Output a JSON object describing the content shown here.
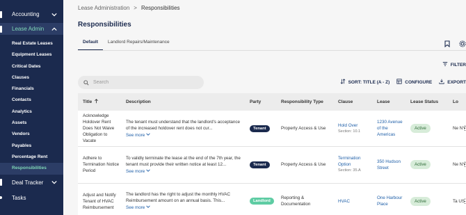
{
  "sidebar": {
    "accounting": "Accounting",
    "lease_admin": "Lease Admin",
    "items": [
      {
        "label": "Real Estate Leases"
      },
      {
        "label": "Equipment Leases"
      },
      {
        "label": "Critical Dates"
      },
      {
        "label": "Clauses"
      },
      {
        "label": "Financials"
      },
      {
        "label": "Contacts"
      },
      {
        "label": "Analytics"
      },
      {
        "label": "Assets"
      },
      {
        "label": "Vendors"
      },
      {
        "label": "Payables"
      },
      {
        "label": "Percentage Rent"
      },
      {
        "label": "Responsibilities"
      }
    ],
    "deal_tracker": "Deal Tracker",
    "tasks": "Tasks"
  },
  "breadcrumb": {
    "parent": "Lease Administration",
    "separator": ">",
    "current": "Responsibilities"
  },
  "page_title": "Responsibilities",
  "tabs": [
    {
      "label": "Default"
    },
    {
      "label": "Landlord Repairs/Maintenance"
    }
  ],
  "filter_label": "FILTER",
  "search": {
    "placeholder": "Search"
  },
  "toolbar": {
    "sort_label": "SORT: TITLE (A - Z)",
    "configure_label": "CONFIGURE",
    "export_label": "EXPORT"
  },
  "table": {
    "headers": {
      "title": "Title",
      "description": "Description",
      "party": "Party",
      "type": "Responsibility Type",
      "clause": "Clause",
      "lease": "Lease",
      "status": "Lease Status",
      "location": "Lo"
    },
    "see_more": "See more",
    "rows": [
      {
        "title": "Acknowledge Holdover Rent Does Not Waive Obligation to Vacate",
        "description": "The tenant must understand that the landlord's acceptance of the increased holdover rent does not cur...",
        "party": "Tenant",
        "type": "Property Access & Use",
        "clause": "Hold Over",
        "section": "Section: 10.1",
        "lease": "1230 Avenue of the Americas",
        "status": "Active",
        "location": "Ne NY"
      },
      {
        "title": "Adhere to Termination Notice Period",
        "description": "To validly terminate the lease at the end of the 7th year, the tenant must provide their written notice at least 12...",
        "party": "Tenant",
        "type": "Property Access & Use",
        "clause": "Termination Option",
        "section": "Section: 35.A",
        "lease": "350 Hudson Street",
        "status": "Active",
        "location": "Ne NY"
      },
      {
        "title": "Adjust and Notify Tenant of HVAC Reimbursement",
        "description": "The landlord has the right to adjust the monthly HVAC Reimbursement amount on an annual basis. This...",
        "party": "Landlord",
        "type": "Reporting & Documentation",
        "clause": "HVAC",
        "section": "",
        "lease": "One Harbour Place",
        "status": "Active",
        "location": "Ta US"
      }
    ]
  },
  "colors": {
    "sidebar_bg": "#1b2a4e",
    "accent": "#7fd8b7",
    "link": "#1f5fa8",
    "landlord": "#5ecca3"
  }
}
